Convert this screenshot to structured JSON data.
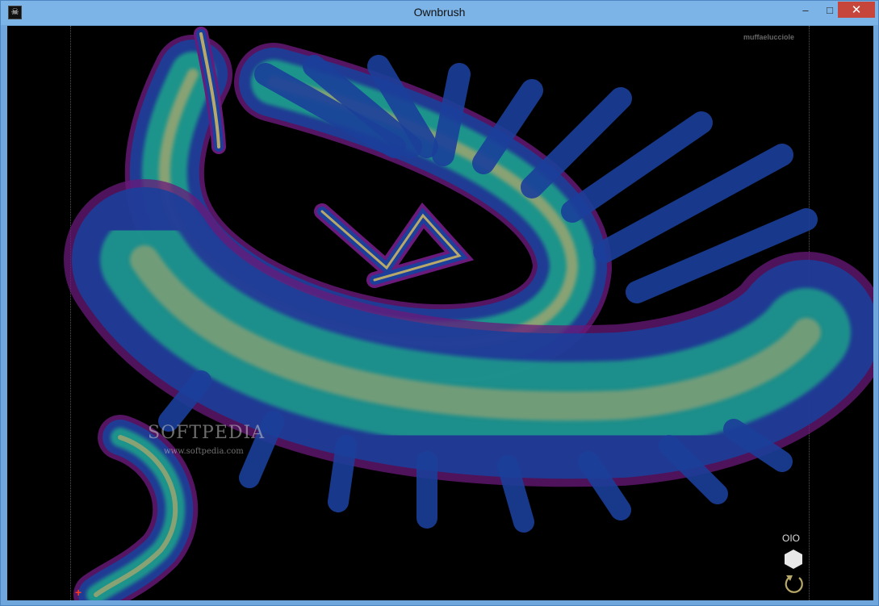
{
  "window": {
    "title": "Ownbrush"
  },
  "controls": {
    "minimize": "–",
    "maximize": "□",
    "close": "✕"
  },
  "canvas": {
    "author_tag": "muffaelucciole",
    "watermark": "SOFTPEDIA",
    "watermark_url": "www.softpedia.com",
    "cursor_glyph": "+"
  },
  "tools": {
    "mirror_label": "OIO"
  },
  "icons": [
    "app-skull-icon",
    "hexagon-icon",
    "undo-icon"
  ],
  "colors": {
    "stroke_core": "#b8a86a",
    "stroke_mid": "#1aa48a",
    "stroke_outer": "#1b3f9a",
    "stroke_edge": "#6a1a7a"
  }
}
